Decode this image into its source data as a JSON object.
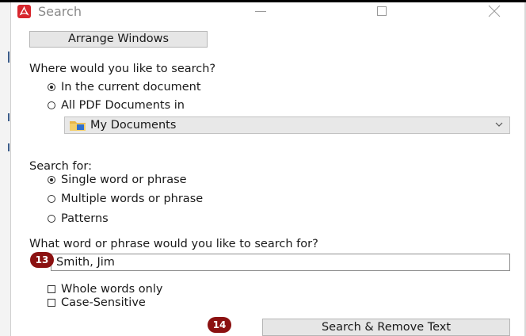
{
  "window": {
    "title": "Search",
    "icon": "pdf-app-icon",
    "accent": "#d7262d"
  },
  "arrange_button": "Arrange Windows",
  "where": {
    "question": "Where would you like to search?",
    "options": [
      "In the current document",
      "All PDF Documents in"
    ],
    "selected_index": 0,
    "location_select": {
      "value": "My Documents",
      "icon": "folder-icon"
    }
  },
  "search_for": {
    "label": "Search for:",
    "options": [
      "Single word or phrase",
      "Multiple words or phrase",
      "Patterns"
    ],
    "selected_index": 0
  },
  "phrase": {
    "question": "What word or phrase would you like to search for?",
    "value": "Smith, Jim"
  },
  "checkboxes": [
    {
      "label": "Whole words only",
      "checked": false
    },
    {
      "label": "Case-Sensitive",
      "checked": false
    }
  ],
  "action_button": "Search & Remove Text",
  "step_badges": {
    "input": "13",
    "action": "14",
    "color": "#8b1111"
  }
}
